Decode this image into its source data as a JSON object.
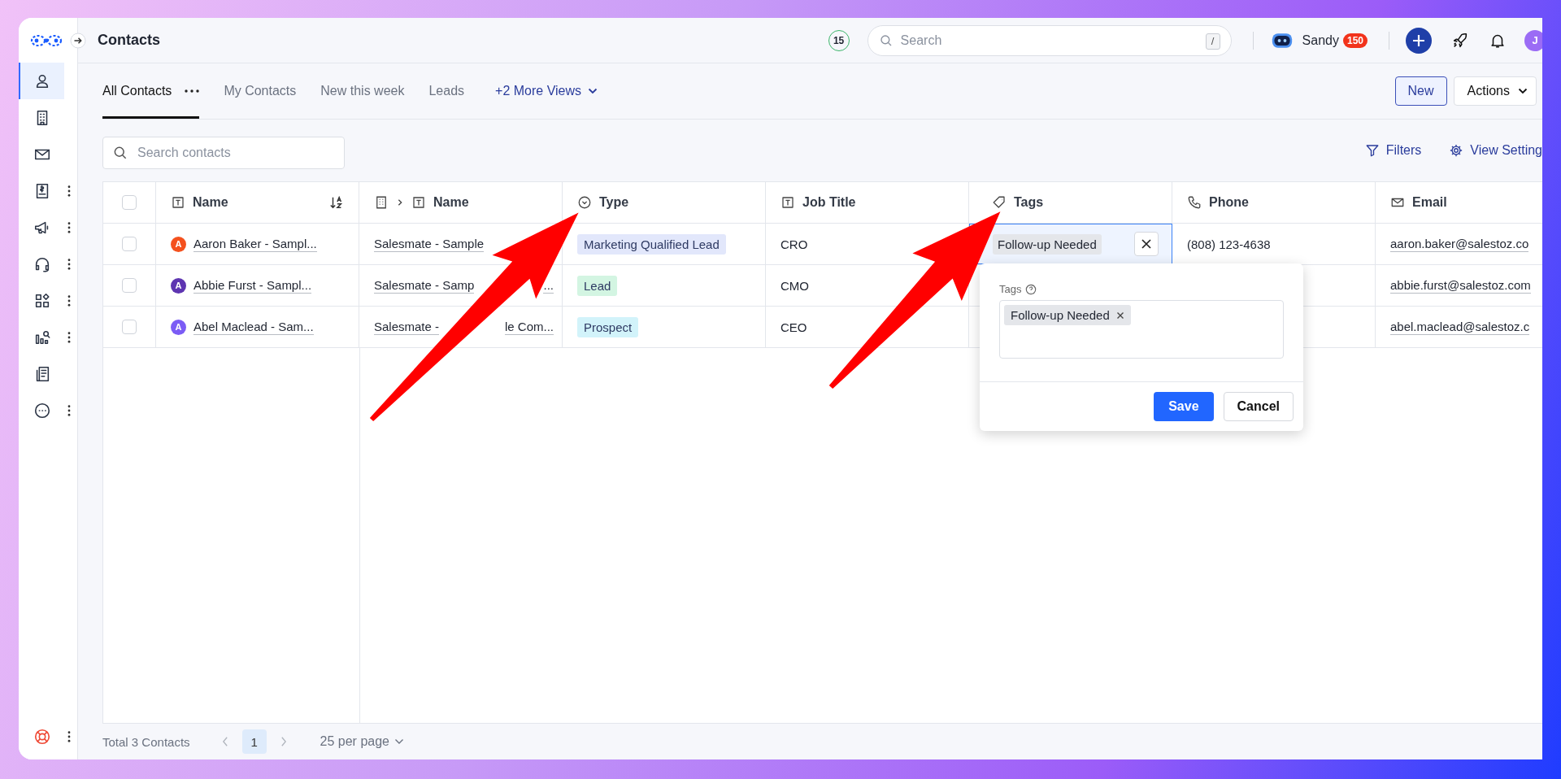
{
  "app": {
    "title": "Contacts",
    "notification_count": "15",
    "search": {
      "placeholder": "Search",
      "shortcut": "/"
    },
    "user": {
      "name": "Sandy",
      "points": "150",
      "avatar_initial": "J"
    }
  },
  "sidebar": {
    "items": [
      {
        "selected": true,
        "menu": false
      },
      {
        "selected": false,
        "menu": false
      },
      {
        "selected": false,
        "menu": false
      },
      {
        "selected": false,
        "menu": true
      },
      {
        "selected": false,
        "menu": true
      },
      {
        "selected": false,
        "menu": true
      },
      {
        "selected": false,
        "menu": true
      },
      {
        "selected": false,
        "menu": true
      },
      {
        "selected": false,
        "menu": false
      },
      {
        "selected": false,
        "menu": true
      }
    ],
    "footer_item": {
      "menu": true
    }
  },
  "views": {
    "tabs": [
      {
        "label": "All Contacts",
        "selected": true,
        "menu": true
      },
      {
        "label": "My Contacts",
        "selected": false,
        "menu": false
      },
      {
        "label": "New this week",
        "selected": false,
        "menu": false
      },
      {
        "label": "Leads",
        "selected": false,
        "menu": false
      }
    ],
    "more": "+2 More Views",
    "new_button": "New",
    "actions_button": "Actions"
  },
  "toolbar": {
    "search_placeholder": "Search contacts",
    "filters": "Filters",
    "view_settings": "View Setting"
  },
  "table": {
    "header_checkbox": {
      "checked": false
    },
    "columns": [
      {
        "label": "Name",
        "kind": "text",
        "sorted": true
      },
      {
        "label": "Name",
        "kind": "company",
        "sorted": false
      },
      {
        "label": "Type",
        "kind": "select",
        "sorted": false
      },
      {
        "label": "Job Title",
        "kind": "text",
        "sorted": false
      },
      {
        "label": "Tags",
        "kind": "tag",
        "sorted": false
      },
      {
        "label": "Phone",
        "kind": "phone",
        "sorted": false
      },
      {
        "label": "Email",
        "kind": "email",
        "sorted": false
      }
    ],
    "rows": [
      {
        "selected": false,
        "avatar": {
          "letter": "A",
          "color": "#f4511e"
        },
        "name": "Aaron Baker - Sampl...",
        "company": [
          "Salesmate - Sample"
        ],
        "type": {
          "label": "Marketing Qualified Lead",
          "color": "#e2e7fb"
        },
        "job_title": "CRO",
        "editing": true,
        "tags": [
          "Follow-up Needed"
        ],
        "phone": "(808) 123-4638",
        "email": "aaron.baker@salestoz.co"
      },
      {
        "selected": false,
        "avatar": {
          "letter": "A",
          "color": "#5e35b1"
        },
        "name": "Abbie Furst - Sampl...",
        "company": [
          "Salesmate - Samp",
          "..."
        ],
        "type": {
          "label": "Lead",
          "color": "#d3f5e2"
        },
        "job_title": "CMO",
        "editing": false,
        "tags": [],
        "email": "abbie.furst@salestoz.com"
      },
      {
        "selected": false,
        "avatar": {
          "letter": "A",
          "color": "#7b5cf5"
        },
        "name": "Abel Maclead - Sam...",
        "company": [
          "Salesmate -",
          "le Com..."
        ],
        "type": {
          "label": "Prospect",
          "color": "#d2f3fa"
        },
        "job_title": "CEO",
        "editing": false,
        "tags": [],
        "email": "abel.maclead@salestoz.c"
      }
    ]
  },
  "tag_editor": {
    "label": "Tags",
    "tags": [
      "Follow-up Needed"
    ],
    "save": "Save",
    "cancel": "Cancel"
  },
  "footer": {
    "total": "Total 3 Contacts",
    "pages": [
      {
        "label": "1",
        "selected": true
      }
    ],
    "per_page": "25 per page"
  }
}
